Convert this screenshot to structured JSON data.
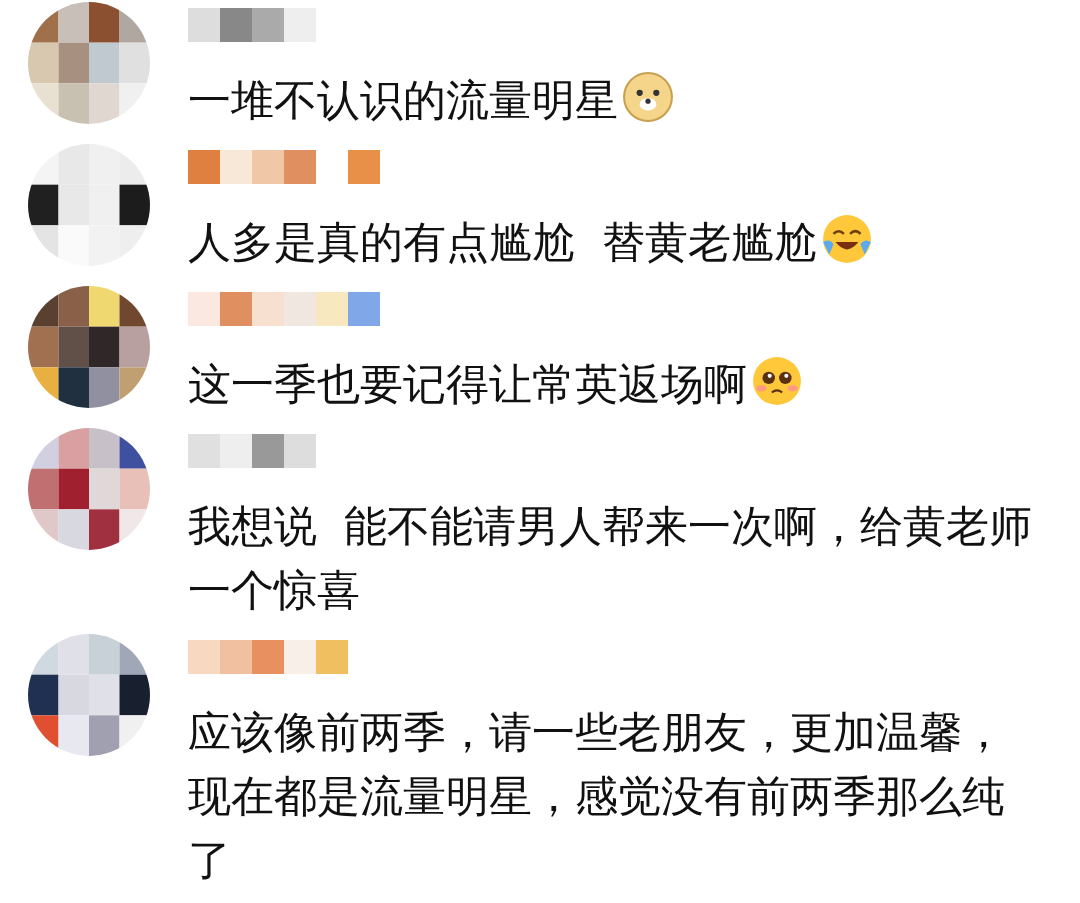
{
  "comments": [
    {
      "lines": [
        "一堆不认识的流量明星"
      ],
      "emoji": true
    },
    {
      "lines": [
        "人多是真的有点尴尬  替黄老尴尬"
      ],
      "emoji": true
    },
    {
      "lines": [
        "这一季也要记得让常英返场啊"
      ],
      "emoji": true
    },
    {
      "lines": [
        "我想说  能不能请男人帮来一次啊，给黄老师",
        "一个惊喜"
      ],
      "emoji": false
    },
    {
      "lines": [
        "应该像前两季，请一些老朋友，更加温馨，",
        "现在都是流量明星，感觉没有前两季那么纯",
        "了"
      ],
      "emoji": false
    }
  ]
}
